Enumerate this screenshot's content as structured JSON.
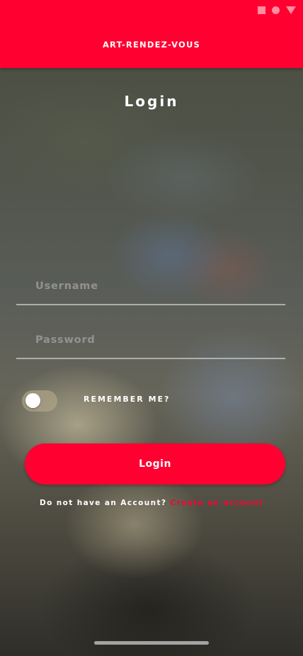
{
  "status_bar": {
    "icons": [
      "square-icon",
      "circle-icon",
      "triangle-icon"
    ]
  },
  "app_bar": {
    "title": "ART-RENDEZ-VOUS",
    "color": "#ff0030"
  },
  "page": {
    "title": "Login"
  },
  "form": {
    "username": {
      "value": "",
      "placeholder": "Username"
    },
    "password": {
      "value": "",
      "placeholder": "Password"
    },
    "remember": {
      "label": "REMEMBER ME?",
      "checked": false
    },
    "submit_label": "Login"
  },
  "signup": {
    "prompt": "Do not have an Account?",
    "link_label": "Create an account",
    "link_color": "#ff0030"
  }
}
